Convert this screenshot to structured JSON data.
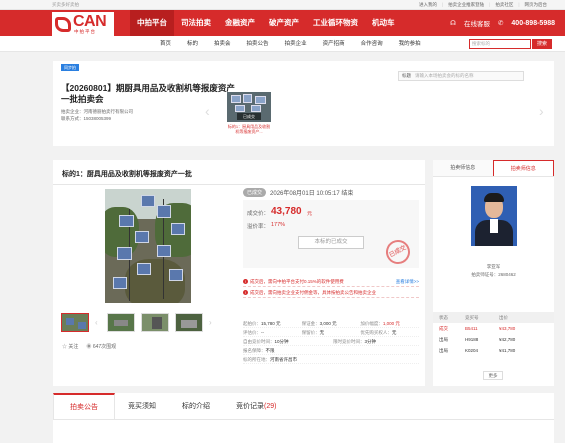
{
  "topbar": {
    "slogan": "买卖多好卖拍",
    "links": [
      "进入我的",
      "拍卖企业推家登陆",
      "拍卖社区",
      "网页为后台"
    ]
  },
  "logo": {
    "text": "CAN",
    "sub": "中拍平台"
  },
  "nav": {
    "items": [
      "中拍平台",
      "司法拍卖",
      "金融资产",
      "破产资产",
      "工业循环物资",
      "机动车"
    ],
    "service": "在线客服",
    "phone": "400-898-5988"
  },
  "subnav": {
    "items": [
      "首页",
      "标的",
      "拍卖会",
      "拍卖公告",
      "拍卖企业",
      "资产招商",
      "合作咨询",
      "我的参拍"
    ],
    "search_placeholder": "搜索标的",
    "search_button": "搜索"
  },
  "session": {
    "tag": "同步拍",
    "title": "【20260801】期厨具用品及收割机等报废资产一批拍卖会",
    "company": "拍卖企业：河南德丽拍卖行有限公司",
    "contact": "联系方式：15038005399",
    "search_label": "标题",
    "search_placeholder": "请输入本场拍卖会的标的名称",
    "thumb_badge": "已成交",
    "thumb_caption": "标的1：厨具用品及收割机等报废资产..."
  },
  "lot": {
    "title": "标的1：厨具用品及收割机等报废资产一批",
    "status": "已成交",
    "end_time": "2026年08月01日 10:05:17 结束",
    "deal_label": "成交价：",
    "deal_price": "43,780",
    "deal_unit": "元",
    "premium_label": "溢价率：",
    "premium": "177%",
    "ended_button": "本标的已成交",
    "stamp": "已成交",
    "notices": [
      {
        "text": "成交后，需向中拍平台支付0.15%的软件使用费",
        "more": "查看详情>>"
      },
      {
        "text": "成交后，需向拍卖企业支付佣金等，具体按拍卖公告和拍卖企业"
      }
    ],
    "details": [
      [
        {
          "k": "起拍价：",
          "v": "15,780 元"
        },
        {
          "k": "保证金：",
          "v": "3,000 元"
        },
        {
          "k": "加价幅度：",
          "v": "1,000 元",
          "red": true
        }
      ],
      [
        {
          "k": "评估价：",
          "v": "--"
        },
        {
          "k": "保留价：",
          "v": "无"
        },
        {
          "k": "优先购买权人：",
          "v": "无"
        }
      ],
      [
        {
          "k": "自由竞价时间：",
          "v": "10分钟"
        },
        {
          "k": "限时竞价时间：",
          "v": "3分钟"
        },
        {
          "k": "",
          "v": ""
        }
      ],
      [
        {
          "k": "报名保障：",
          "v": "不限"
        },
        {
          "k": "",
          "v": ""
        },
        {
          "k": "",
          "v": ""
        }
      ],
      [
        {
          "k": "标的所在地：",
          "v": "河南省许昌市"
        },
        {
          "k": "",
          "v": ""
        },
        {
          "k": "",
          "v": ""
        }
      ]
    ],
    "follow": "关注",
    "views": "647次围观"
  },
  "side": {
    "tabs": [
      "拍卖师信息",
      "拍卖师信息"
    ],
    "name": "李亚军",
    "cert": "拍卖师证号：2680462",
    "bid_headers": [
      "状态",
      "竞买号",
      "出价"
    ],
    "bids": [
      {
        "status": "成交",
        "no": "B5411",
        "price": "¥43,780",
        "win": true
      },
      {
        "status": "出局",
        "no": "H9188",
        "price": "¥42,780"
      },
      {
        "status": "出局",
        "no": "K0204",
        "price": "¥41,780"
      }
    ],
    "more": "更多"
  },
  "bottom_tabs": {
    "items": [
      "拍卖公告",
      "竞买须知",
      "标的介绍",
      "竞价记录"
    ],
    "record_count": "(29)"
  }
}
